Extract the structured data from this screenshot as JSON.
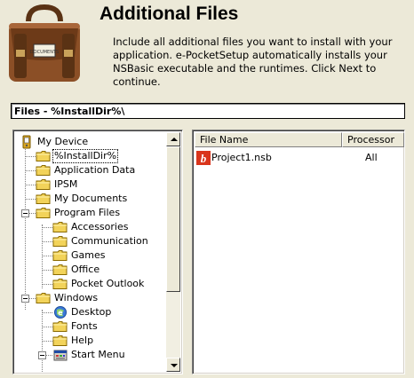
{
  "header": {
    "title": "Additional Files",
    "description": "Include all additional files you want to install with your application. e-PocketSetup automatically installs your NSBasic executable and the runtimes. Click Next to continue.",
    "satchel_label": "DOCUMENTS"
  },
  "path_bar": {
    "text": "Files - %InstallDir%\\"
  },
  "tree": {
    "items": [
      {
        "label": "My Device",
        "icon": "device-icon"
      },
      {
        "label": "%InstallDir%",
        "icon": "folder-icon",
        "selected": true
      },
      {
        "label": "Application Data",
        "icon": "folder-icon"
      },
      {
        "label": "IPSM",
        "icon": "folder-icon"
      },
      {
        "label": "My Documents",
        "icon": "folder-icon"
      },
      {
        "label": "Program Files",
        "icon": "folder-icon",
        "expanded": true
      },
      {
        "label": "Accessories",
        "icon": "folder-icon"
      },
      {
        "label": "Communication",
        "icon": "folder-icon"
      },
      {
        "label": "Games",
        "icon": "folder-icon"
      },
      {
        "label": "Office",
        "icon": "folder-icon"
      },
      {
        "label": "Pocket Outlook",
        "icon": "folder-icon"
      },
      {
        "label": "Windows",
        "icon": "folder-icon",
        "expanded": true
      },
      {
        "label": "Desktop",
        "icon": "desktop-icon"
      },
      {
        "label": "Fonts",
        "icon": "folder-icon"
      },
      {
        "label": "Help",
        "icon": "folder-icon"
      },
      {
        "label": "Start Menu",
        "icon": "start-menu-icon",
        "expanded": true
      }
    ]
  },
  "file_list": {
    "columns": [
      "File Name",
      "Processor"
    ],
    "rows": [
      {
        "name": "Project1.nsb",
        "processor": "All",
        "icon": "nsbasic-file-icon",
        "icon_glyph": "b"
      }
    ]
  },
  "colors": {
    "dialog_background": "#ece9d8",
    "satchel_brown": "#8b4f26",
    "folder_yellow": "#f2d35a",
    "nsb_icon_red": "#d9351c"
  }
}
